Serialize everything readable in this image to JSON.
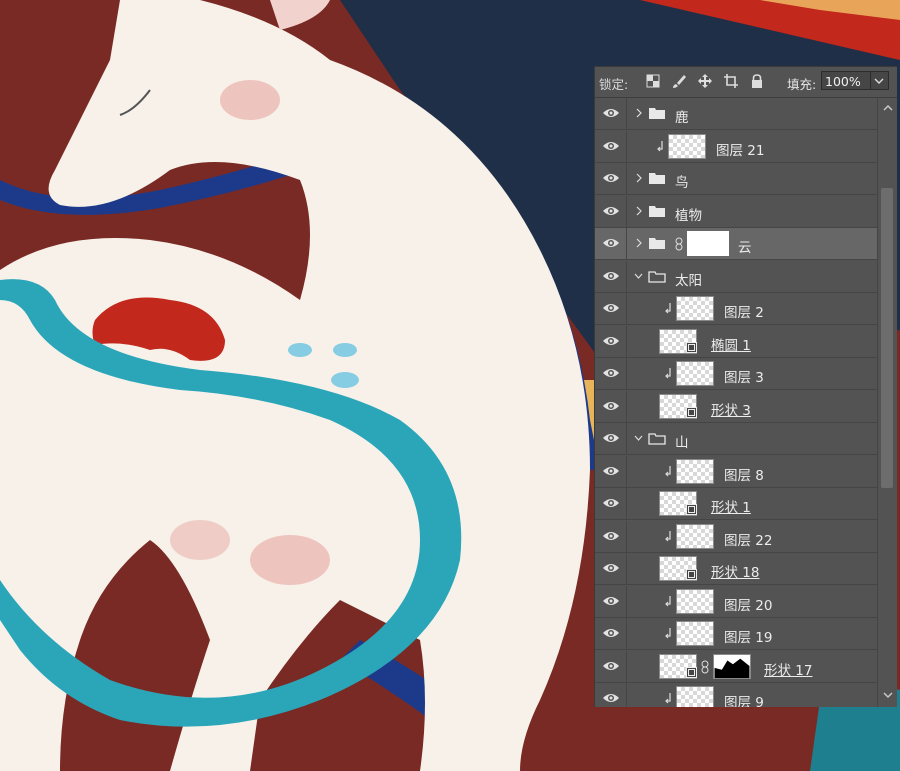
{
  "panel": {
    "lock_label": "锁定:",
    "fill_label": "填充:",
    "fill_value": "100%"
  },
  "layers": [
    {
      "name": "鹿",
      "type": "group",
      "expanded": false,
      "indent": 0
    },
    {
      "name": "图层 21",
      "type": "pixel",
      "clipped": true,
      "indent": 0
    },
    {
      "name": "鸟",
      "type": "group",
      "expanded": false,
      "indent": 0
    },
    {
      "name": "植物",
      "type": "group",
      "expanded": false,
      "indent": 0
    },
    {
      "name": "云",
      "type": "group",
      "expanded": false,
      "mask": true,
      "selected": true,
      "indent": 0
    },
    {
      "name": "太阳",
      "type": "group",
      "expanded": true,
      "indent": 0
    },
    {
      "name": "图层 2",
      "type": "pixel",
      "clipped": true,
      "indent": 1
    },
    {
      "name": "椭圆 1",
      "type": "shape",
      "indent": 1
    },
    {
      "name": "图层 3",
      "type": "pixel",
      "clipped": true,
      "indent": 1
    },
    {
      "name": "形状 3",
      "type": "shape",
      "indent": 1
    },
    {
      "name": "山",
      "type": "group",
      "expanded": true,
      "indent": 0
    },
    {
      "name": "图层 8",
      "type": "pixel",
      "clipped": true,
      "indent": 1
    },
    {
      "name": "形状 1",
      "type": "shape",
      "indent": 1
    },
    {
      "name": "图层 22",
      "type": "pixel",
      "clipped": true,
      "indent": 1
    },
    {
      "name": "形状 18",
      "type": "shape",
      "indent": 1
    },
    {
      "name": "图层 20",
      "type": "pixel",
      "clipped": true,
      "indent": 1
    },
    {
      "name": "图层 19",
      "type": "pixel",
      "clipped": true,
      "indent": 1
    },
    {
      "name": "形状 17",
      "type": "shape",
      "mask": true,
      "indent": 1
    },
    {
      "name": "图层 9",
      "type": "pixel",
      "clipped": true,
      "indent": 1
    }
  ],
  "colors": {
    "panel_bg": "#535353",
    "selected_row": "#676767",
    "canvas_red": "#7a2a24",
    "deer_white": "#f7f1ea",
    "ribbon_teal": "#2aa6b8",
    "ribbon_navy": "#1d3a8a"
  }
}
